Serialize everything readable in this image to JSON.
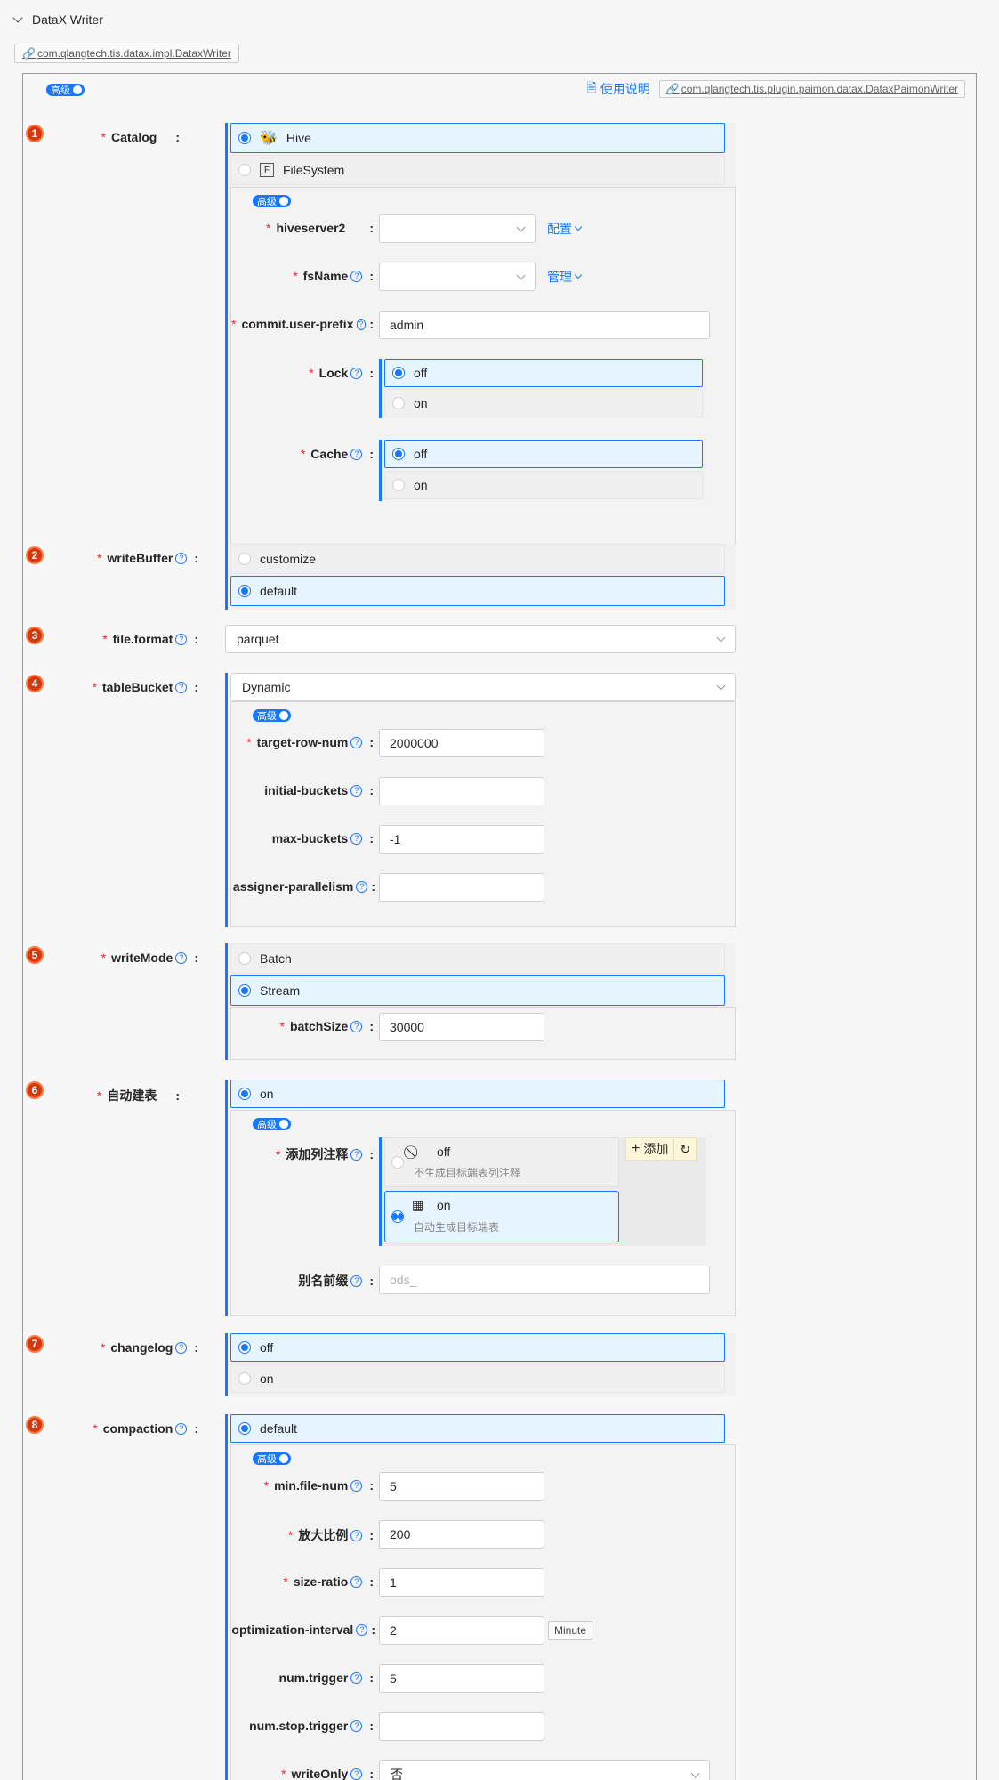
{
  "header": {
    "title": "DataX Writer",
    "impl_class": "com.qlangtech.tis.datax.impl.DataxWriter"
  },
  "top": {
    "doc_link": "使用说明",
    "plugin_class": "com.qlangtech.tis.plugin.paimon.datax.DataxPaimonWriter",
    "toggle": "高级"
  },
  "toggle_label": "高级",
  "sections": {
    "catalog": {
      "num": "1",
      "label": "Catalog",
      "options": [
        "Hive",
        "FileSystem"
      ],
      "selected": "Hive",
      "fields": {
        "hiveserver2": {
          "label": "hiveserver2",
          "action": "配置"
        },
        "fsName": {
          "label": "fsName",
          "action": "管理"
        },
        "commit": {
          "label": "commit.user-prefix",
          "value": "admin"
        },
        "lock": {
          "label": "Lock",
          "options": [
            "off",
            "on"
          ],
          "selected": "off"
        },
        "cache": {
          "label": "Cache",
          "options": [
            "off",
            "on"
          ],
          "selected": "off"
        }
      }
    },
    "writeBuffer": {
      "num": "2",
      "label": "writeBuffer",
      "options": [
        "customize",
        "default"
      ],
      "selected": "default"
    },
    "fileFormat": {
      "num": "3",
      "label": "file.format",
      "value": "parquet"
    },
    "tableBucket": {
      "num": "4",
      "label": "tableBucket",
      "value": "Dynamic",
      "fields": {
        "targetRowNum": {
          "label": "target-row-num",
          "value": "2000000"
        },
        "initialBuckets": {
          "label": "initial-buckets",
          "value": ""
        },
        "maxBuckets": {
          "label": "max-buckets",
          "value": "-1"
        },
        "assignerParallelism": {
          "label": "assigner-parallelism",
          "value": ""
        }
      }
    },
    "writeMode": {
      "num": "5",
      "label": "writeMode",
      "options": [
        "Batch",
        "Stream"
      ],
      "selected": "Stream",
      "fields": {
        "batchSize": {
          "label": "batchSize",
          "value": "30000"
        }
      }
    },
    "autoCreate": {
      "num": "6",
      "label": "自动建表",
      "option": "on",
      "fields": {
        "addComment": {
          "label": "添加列注释",
          "off_title": "off",
          "off_desc": "不生成目标端表列注释",
          "on_title": "on",
          "on_desc": "自动生成目标端表",
          "add_btn": "添加"
        },
        "aliasPrefix": {
          "label": "别名前缀",
          "placeholder": "ods_"
        }
      }
    },
    "changelog": {
      "num": "7",
      "label": "changelog",
      "options": [
        "off",
        "on"
      ],
      "selected": "off"
    },
    "compaction": {
      "num": "8",
      "label": "compaction",
      "option": "default",
      "fields": {
        "minFileNum": {
          "label": "min.file-num",
          "value": "5"
        },
        "ampRatio": {
          "label": "放大比例",
          "value": "200"
        },
        "sizeRatio": {
          "label": "size-ratio",
          "value": "1"
        },
        "optInterval": {
          "label": "optimization-interval",
          "value": "2",
          "unit": "Minute"
        },
        "numTrigger": {
          "label": "num.trigger",
          "value": "5"
        },
        "numStopTrigger": {
          "label": "num.stop.trigger",
          "value": ""
        },
        "writeOnly": {
          "label": "writeOnly",
          "value": "否"
        }
      }
    }
  }
}
